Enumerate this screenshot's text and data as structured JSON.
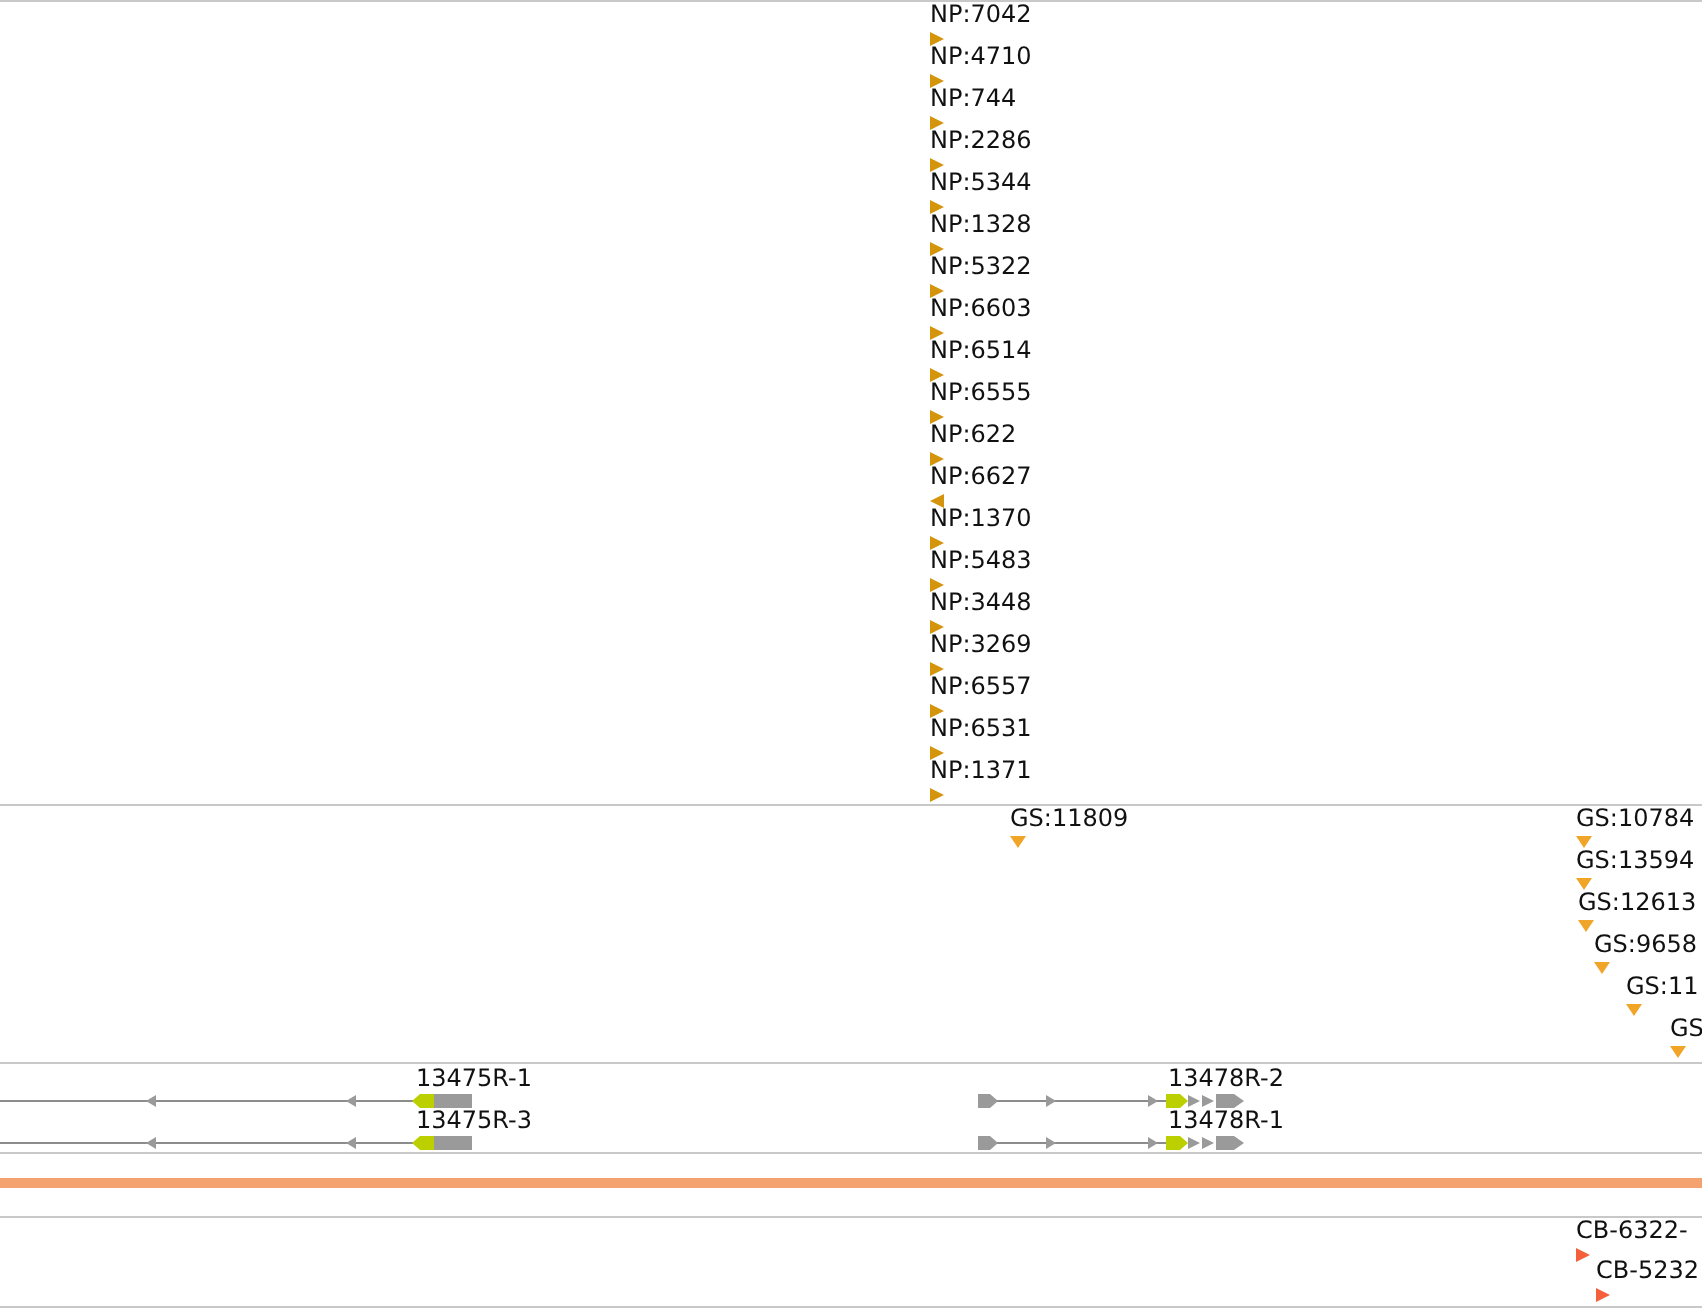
{
  "np_track": {
    "features": [
      {
        "label": "NP:7042",
        "reverse": false
      },
      {
        "label": "NP:4710",
        "reverse": false
      },
      {
        "label": "NP:744",
        "reverse": false
      },
      {
        "label": "NP:2286",
        "reverse": false
      },
      {
        "label": "NP:5344",
        "reverse": false
      },
      {
        "label": "NP:1328",
        "reverse": false
      },
      {
        "label": "NP:5322",
        "reverse": false
      },
      {
        "label": "NP:6603",
        "reverse": false
      },
      {
        "label": "NP:6514",
        "reverse": false
      },
      {
        "label": "NP:6555",
        "reverse": false
      },
      {
        "label": "NP:622",
        "reverse": false
      },
      {
        "label": "NP:6627",
        "reverse": true
      },
      {
        "label": "NP:1370",
        "reverse": false
      },
      {
        "label": "NP:5483",
        "reverse": false
      },
      {
        "label": "NP:3448",
        "reverse": false
      },
      {
        "label": "NP:3269",
        "reverse": false
      },
      {
        "label": "NP:6557",
        "reverse": false
      },
      {
        "label": "NP:6531",
        "reverse": false
      },
      {
        "label": "NP:1371",
        "reverse": false
      }
    ]
  },
  "gs_track": {
    "left_features": [
      {
        "label": "GS:11809"
      }
    ],
    "right_features": [
      {
        "label": "GS:10784"
      },
      {
        "label": "GS:13594"
      },
      {
        "label": "GS:12613"
      },
      {
        "label": "GS:9658"
      },
      {
        "label": "GS:11"
      },
      {
        "label": "GS"
      }
    ]
  },
  "gene_rows": [
    {
      "genes": [
        {
          "label": "13475R-1",
          "reverse": true
        },
        {
          "label": "13478R-2",
          "reverse": false
        }
      ]
    },
    {
      "genes": [
        {
          "label": "13475R-3",
          "reverse": true
        },
        {
          "label": "13478R-1",
          "reverse": false
        }
      ]
    }
  ],
  "cb_track": {
    "features": [
      {
        "label": "CB-6322-",
        "reverse": false
      },
      {
        "label": "CB-5232",
        "reverse": false
      }
    ]
  }
}
